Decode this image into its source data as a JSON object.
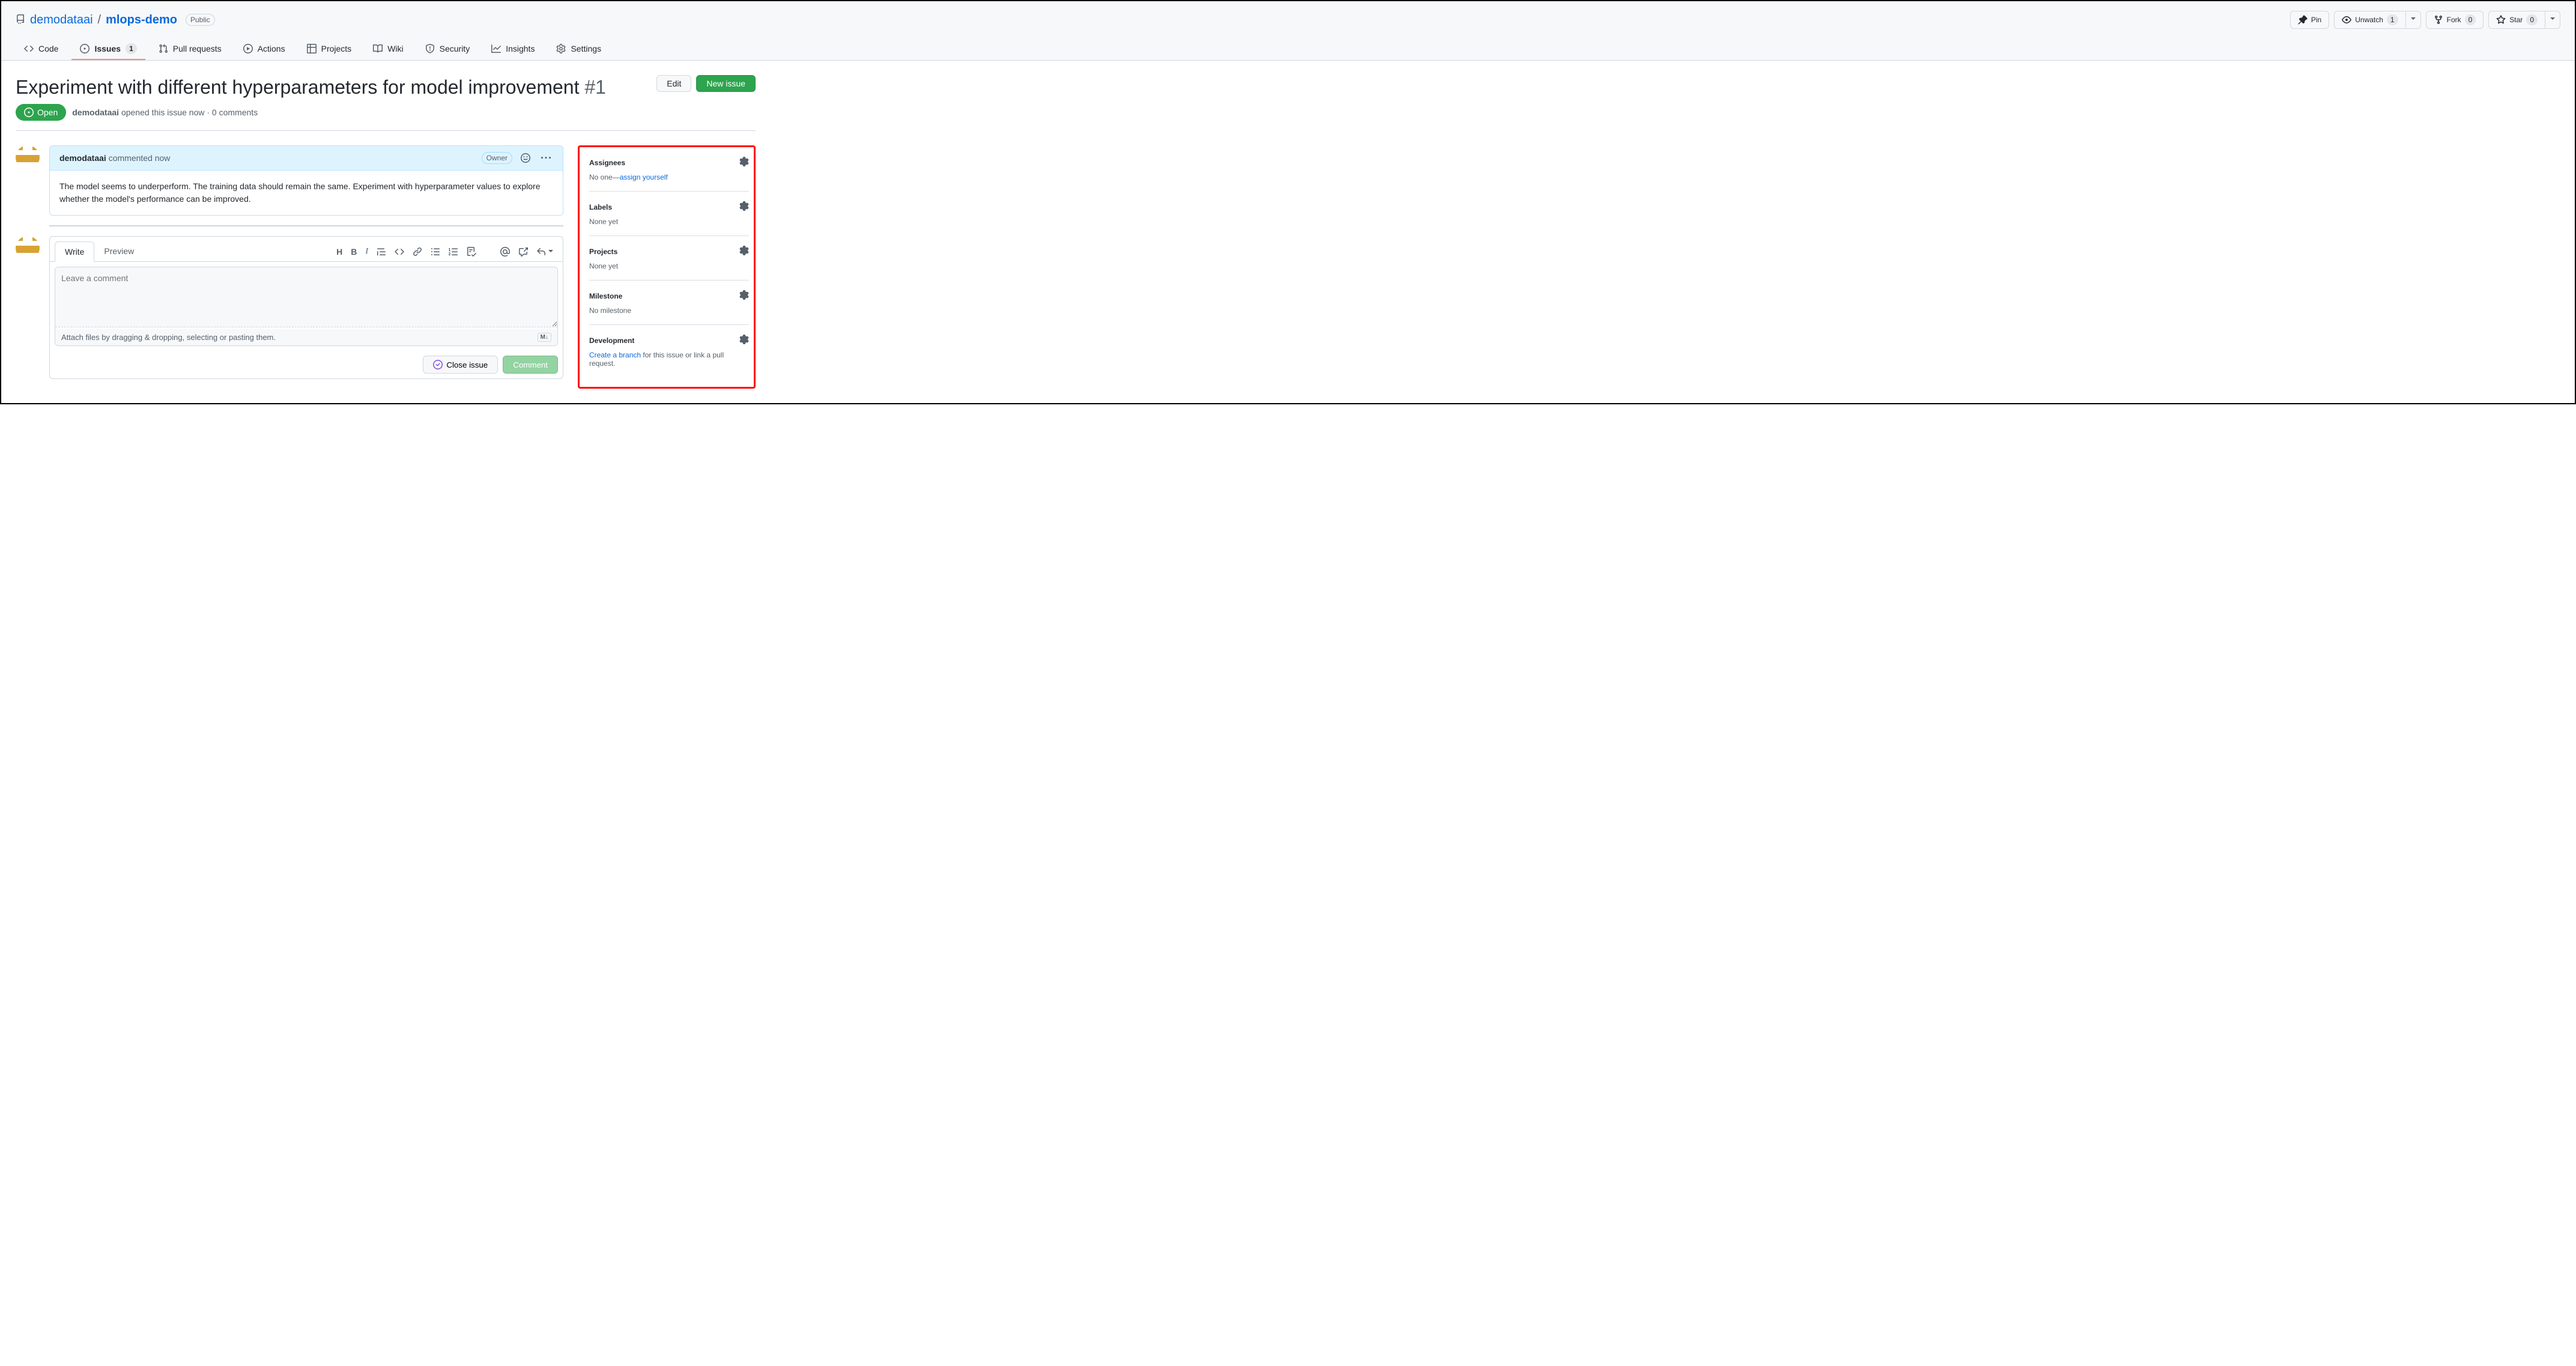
{
  "repo": {
    "owner": "demodataai",
    "name": "mlops-demo",
    "visibility": "Public"
  },
  "actions": {
    "pin": "Pin",
    "unwatch": "Unwatch",
    "watch_count": "1",
    "fork": "Fork",
    "fork_count": "0",
    "star": "Star",
    "star_count": "0"
  },
  "nav": {
    "code": "Code",
    "issues": "Issues",
    "issues_count": "1",
    "pull_requests": "Pull requests",
    "actions": "Actions",
    "projects": "Projects",
    "wiki": "Wiki",
    "security": "Security",
    "insights": "Insights",
    "settings": "Settings"
  },
  "issue": {
    "title": "Experiment with different hyperparameters for model improvement",
    "number": "#1",
    "edit": "Edit",
    "new_issue": "New issue",
    "state": "Open",
    "author": "demodataai",
    "meta_text": " opened this issue now · 0 comments"
  },
  "comment": {
    "author": "demodataai",
    "action": " commented now",
    "role": "Owner",
    "body": "The model seems to underperform. The training data should remain the same. Experiment with hyperparameter values to explore whether the model's performance can be improved."
  },
  "form": {
    "write_tab": "Write",
    "preview_tab": "Preview",
    "placeholder": "Leave a comment",
    "attach_hint": "Attach files by dragging & dropping, selecting or pasting them.",
    "md_badge": "M↓",
    "close": "Close issue",
    "comment": "Comment"
  },
  "sidebar": {
    "assignees": {
      "title": "Assignees",
      "content_prefix": "No one—",
      "link": "assign yourself"
    },
    "labels": {
      "title": "Labels",
      "content": "None yet"
    },
    "projects": {
      "title": "Projects",
      "content": "None yet"
    },
    "milestone": {
      "title": "Milestone",
      "content": "No milestone"
    },
    "development": {
      "title": "Development",
      "link": "Create a branch",
      "suffix": " for this issue or link a pull request."
    }
  }
}
